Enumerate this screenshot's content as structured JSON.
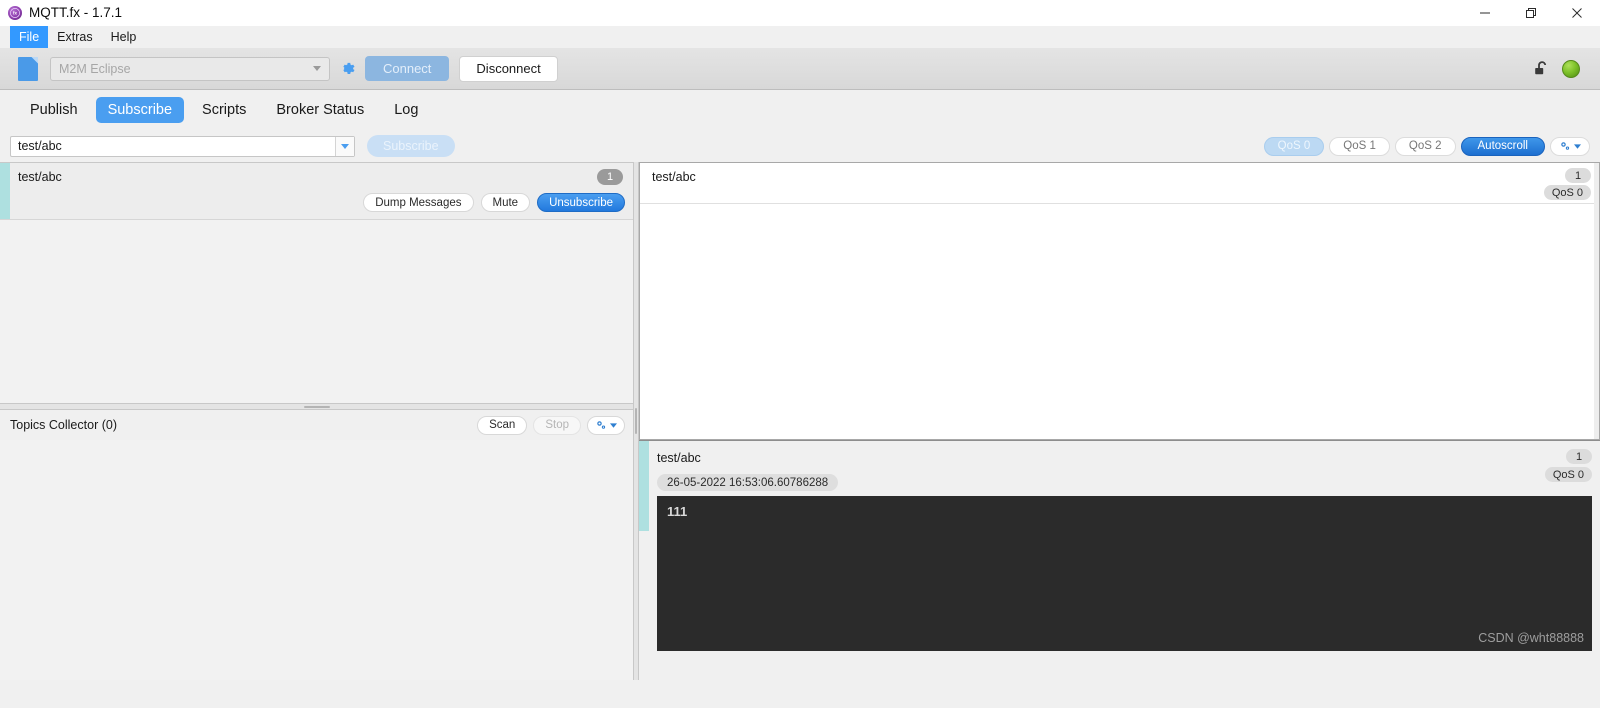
{
  "window": {
    "title": "MQTT.fx - 1.7.1",
    "app_icon": "mqttfx-logo-icon",
    "controls": {
      "minimize": "—",
      "restore": "❐",
      "close": "✕"
    }
  },
  "menubar": {
    "items": [
      {
        "label": "File",
        "active": true
      },
      {
        "label": "Extras",
        "active": false
      },
      {
        "label": "Help",
        "active": false
      }
    ]
  },
  "connection_bar": {
    "document_icon": "document-icon",
    "profile": {
      "value": "M2M Eclipse",
      "placeholder": "M2M Eclipse"
    },
    "settings_icon": "gear-icon",
    "connect_label": "Connect",
    "connect_enabled": false,
    "disconnect_label": "Disconnect",
    "disconnect_enabled": true,
    "lock_icon": "unlocked-padlock-icon",
    "status_indicator": "connected-green-led",
    "status_color": "#7ec22a"
  },
  "tabs": [
    {
      "label": "Publish",
      "active": false
    },
    {
      "label": "Subscribe",
      "active": true
    },
    {
      "label": "Scripts",
      "active": false
    },
    {
      "label": "Broker Status",
      "active": false
    },
    {
      "label": "Log",
      "active": false
    }
  ],
  "subscribe_bar": {
    "topic": {
      "value": "test/abc",
      "placeholder": "Topic"
    },
    "dropdown_icon": "chevron-down-icon",
    "subscribe_label": "Subscribe",
    "subscribe_enabled": false,
    "qos_options": [
      {
        "label": "QoS 0",
        "selected": true
      },
      {
        "label": "QoS 1",
        "selected": false
      },
      {
        "label": "QoS 2",
        "selected": false
      }
    ],
    "autoscroll_label": "Autoscroll",
    "autoscroll_active": true,
    "options_icon": "gear-dropdown-icon"
  },
  "subscriptions": [
    {
      "topic": "test/abc",
      "count": "1",
      "selected": true,
      "accent_color": "#aee0e0",
      "buttons": {
        "dump": "Dump Messages",
        "mute": "Mute",
        "unsubscribe": "Unsubscribe"
      }
    }
  ],
  "topics_collector": {
    "label": "Topics Collector (0)",
    "scan_label": "Scan",
    "scan_enabled": true,
    "stop_label": "Stop",
    "stop_enabled": false,
    "options_icon": "gear-dropdown-icon"
  },
  "messages": [
    {
      "topic": "test/abc",
      "count": "1",
      "qos": "QoS 0"
    }
  ],
  "message_detail": {
    "topic": "test/abc",
    "count": "1",
    "qos": "QoS 0",
    "timestamp": "26-05-2022 16:53:06.60786288",
    "payload": "111",
    "accent_color": "#aee0e0",
    "payload_bg": "#2b2b2b"
  },
  "watermark": "CSDN @wht88888"
}
